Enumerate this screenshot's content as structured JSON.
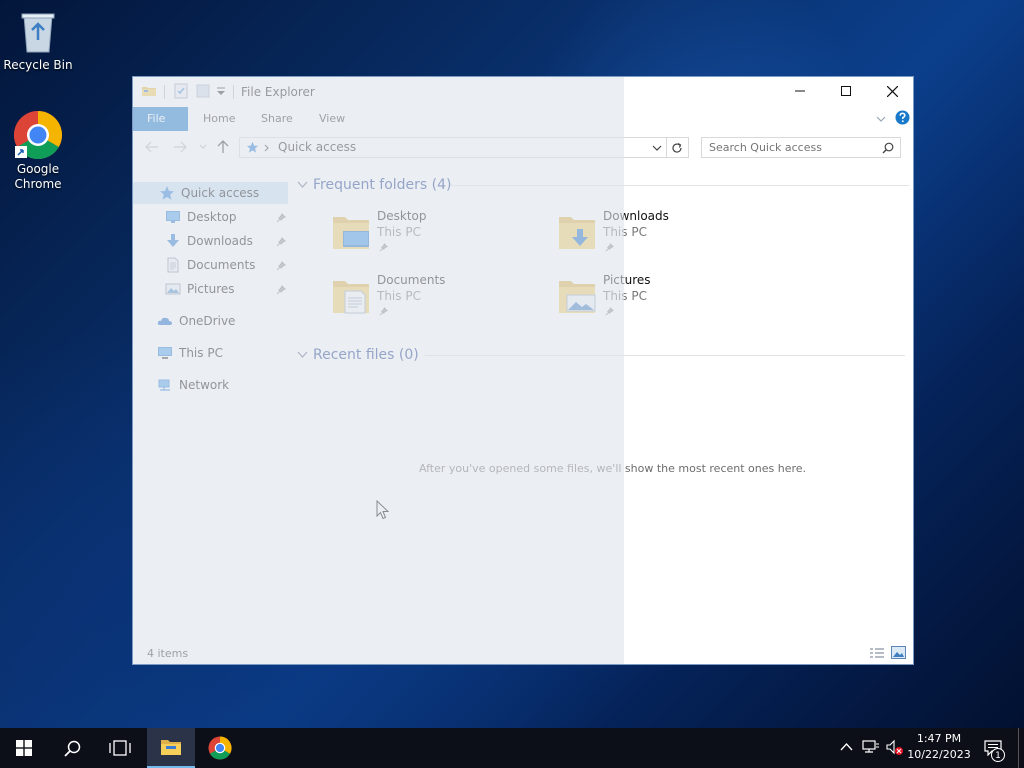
{
  "desktop": {
    "icons": [
      {
        "label": "Recycle Bin"
      },
      {
        "label": "Google Chrome"
      }
    ]
  },
  "window": {
    "title": "File Explorer",
    "ribbon_tabs": [
      "File",
      "Home",
      "Share",
      "View"
    ],
    "address": {
      "path": "Quick access"
    },
    "search": {
      "placeholder": "Search Quick access"
    },
    "nav": {
      "quick_access": "Quick access",
      "items": [
        {
          "label": "Desktop",
          "pinned": true
        },
        {
          "label": "Downloads",
          "pinned": true
        },
        {
          "label": "Documents",
          "pinned": true
        },
        {
          "label": "Pictures",
          "pinned": true
        }
      ],
      "onedrive": "OneDrive",
      "this_pc": "This PC",
      "network": "Network"
    },
    "frequent": {
      "title": "Frequent folders (4)",
      "folders": [
        {
          "name": "Desktop",
          "location": "This PC"
        },
        {
          "name": "Downloads",
          "location": "This PC"
        },
        {
          "name": "Documents",
          "location": "This PC"
        },
        {
          "name": "Pictures",
          "location": "This PC"
        }
      ]
    },
    "recent": {
      "title": "Recent files (0)",
      "empty_message": "After you've opened some files, we'll show the most recent ones here."
    },
    "status": "4 items"
  },
  "taskbar": {
    "time": "1:47 PM",
    "date": "10/22/2023",
    "notification_count": "1"
  },
  "colors": {
    "accent": "#1979ca",
    "selection": "#cde3f7",
    "group_heading": "#1e3f8f"
  }
}
